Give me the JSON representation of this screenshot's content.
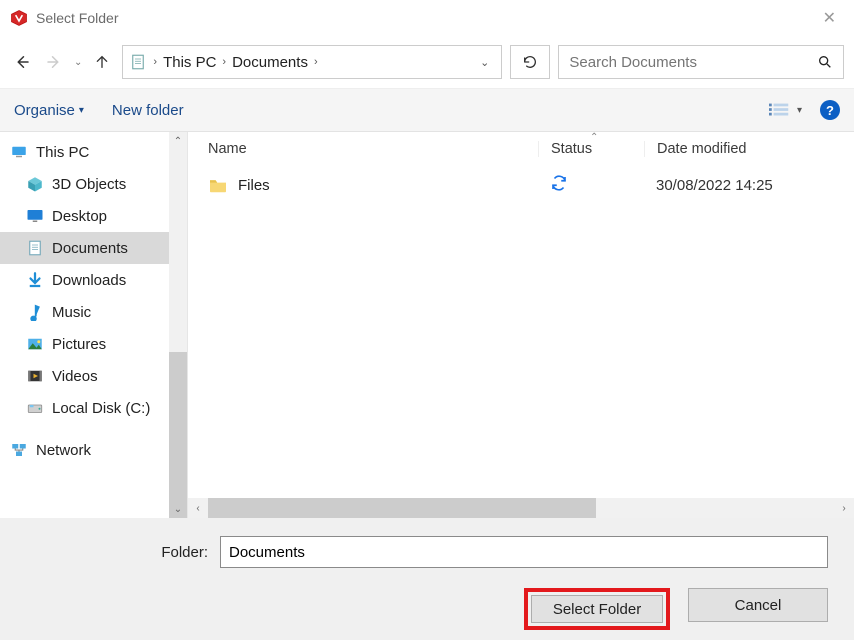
{
  "window": {
    "title": "Select Folder"
  },
  "breadcrumbs": [
    "This PC",
    "Documents"
  ],
  "search": {
    "placeholder": "Search Documents"
  },
  "toolbar": {
    "organise": "Organise",
    "new_folder": "New folder"
  },
  "tree": {
    "root": "This PC",
    "items": [
      {
        "label": "3D Objects",
        "icon": "cube"
      },
      {
        "label": "Desktop",
        "icon": "desktop"
      },
      {
        "label": "Documents",
        "icon": "doc",
        "selected": true
      },
      {
        "label": "Downloads",
        "icon": "download"
      },
      {
        "label": "Music",
        "icon": "music"
      },
      {
        "label": "Pictures",
        "icon": "picture"
      },
      {
        "label": "Videos",
        "icon": "video"
      },
      {
        "label": "Local Disk (C:)",
        "icon": "disk"
      }
    ],
    "network": "Network"
  },
  "columns": {
    "name": "Name",
    "status": "Status",
    "date": "Date modified"
  },
  "rows": [
    {
      "name": "Files",
      "status": "sync",
      "date": "30/08/2022 14:25"
    }
  ],
  "footer": {
    "folder_label": "Folder:",
    "folder_value": "Documents",
    "select": "Select Folder",
    "cancel": "Cancel"
  },
  "help_glyph": "?"
}
